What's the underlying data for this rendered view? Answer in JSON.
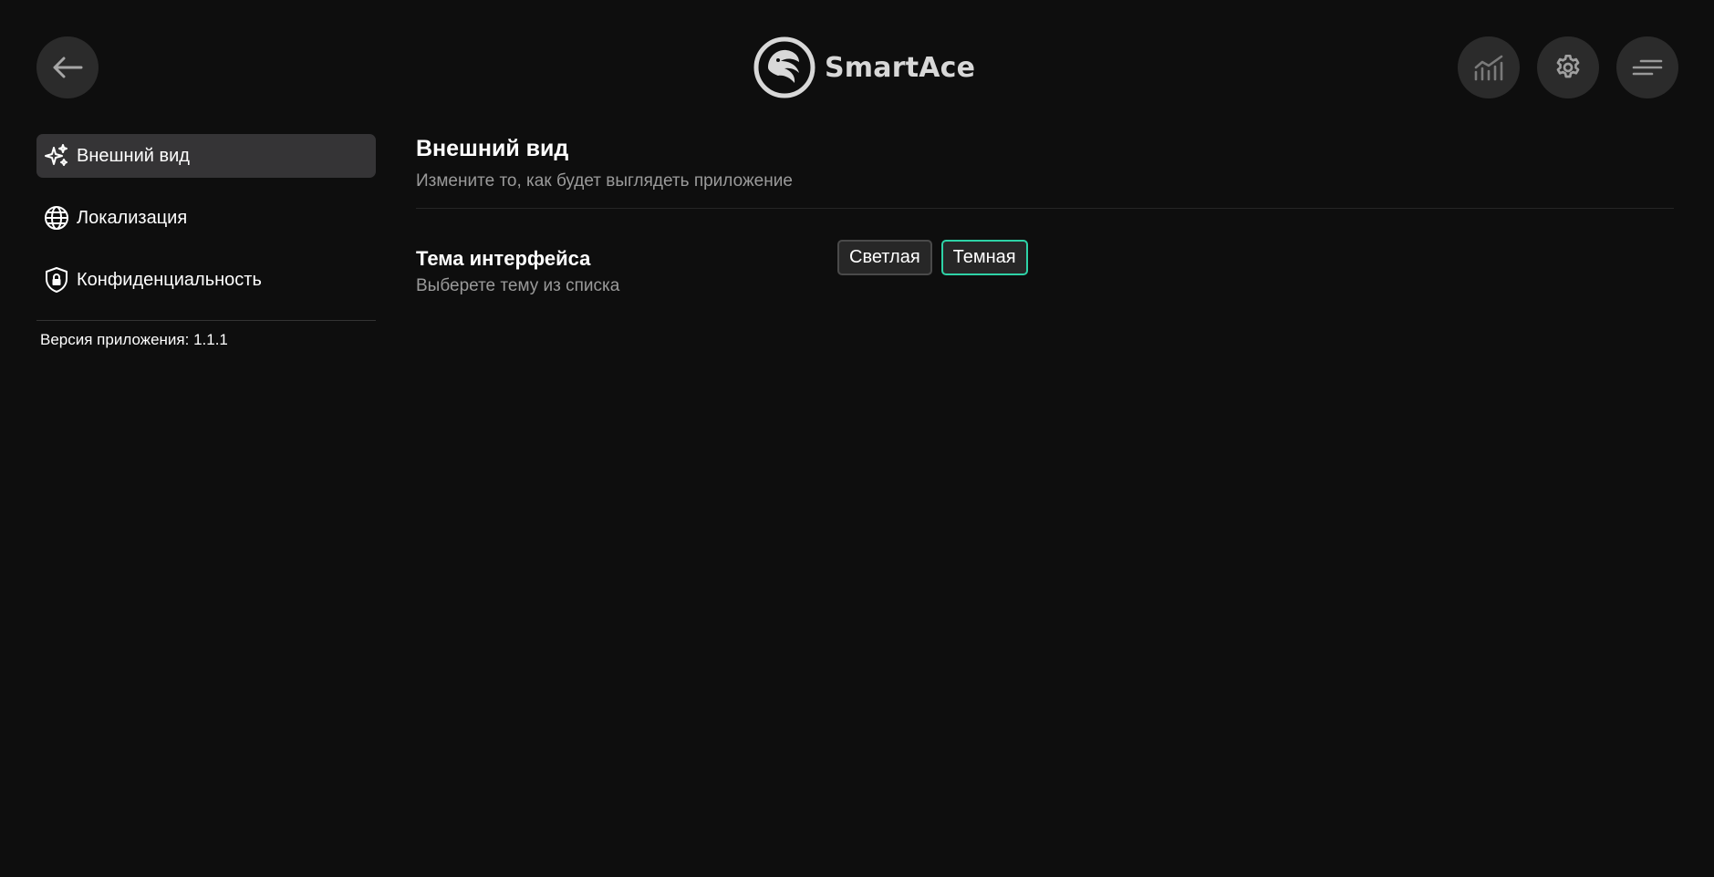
{
  "header": {
    "brand": "SmartAce",
    "back_icon": "arrow-left-icon",
    "stats_icon": "chart-icon",
    "settings_icon": "gear-icon",
    "menu_icon": "menu-lines-icon"
  },
  "sidebar": {
    "items": [
      {
        "label": "Внешний вид",
        "icon": "sparkles-icon",
        "active": true
      },
      {
        "label": "Локализация",
        "icon": "globe-icon",
        "active": false
      },
      {
        "label": "Конфиденциальность",
        "icon": "shield-lock-icon",
        "active": false
      }
    ],
    "version": "Версия приложения: 1.1.1"
  },
  "main": {
    "title": "Внешний вид",
    "subtitle": "Измените то, как будет выглядеть приложение",
    "theme_setting": {
      "title": "Тема интерфейса",
      "description": "Выберете тему из списка",
      "options": [
        {
          "label": "Светлая",
          "selected": false
        },
        {
          "label": "Темная",
          "selected": true
        }
      ]
    }
  },
  "colors": {
    "background": "#0e0e0e",
    "active_item": "#353436",
    "accent": "#2ed2a6",
    "muted_text": "#9a9a9a"
  }
}
